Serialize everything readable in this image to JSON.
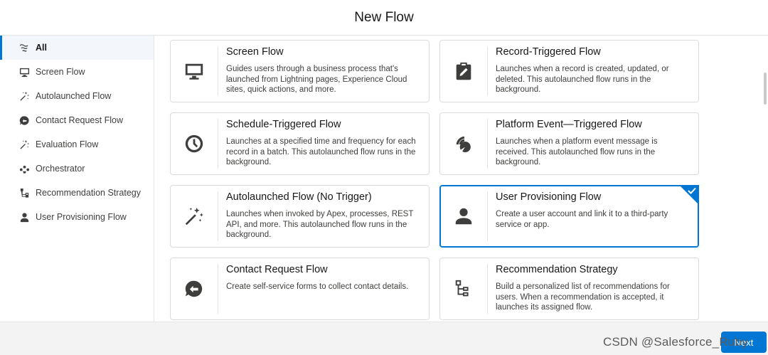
{
  "header": {
    "title": "New Flow"
  },
  "sidebar": {
    "items": [
      {
        "label": "All",
        "icon": "filter-icon"
      },
      {
        "label": "Screen Flow",
        "icon": "desktop-icon"
      },
      {
        "label": "Autolaunched Flow",
        "icon": "magic-wand-icon"
      },
      {
        "label": "Contact Request Flow",
        "icon": "chat-callback-icon"
      },
      {
        "label": "Evaluation Flow",
        "icon": "magic-wand-icon"
      },
      {
        "label": "Orchestrator",
        "icon": "orchestrator-icon"
      },
      {
        "label": "Recommendation Strategy",
        "icon": "hierarchy-icon"
      },
      {
        "label": "User Provisioning Flow",
        "icon": "user-icon"
      }
    ]
  },
  "cards": [
    {
      "title": "Screen Flow",
      "description": "Guides users through a business process that's launched from Lightning pages, Experience Cloud sites, quick actions, and more.",
      "icon": "desktop-icon"
    },
    {
      "title": "Record-Triggered Flow",
      "description": "Launches when a record is created, updated, or deleted. This autolaunched flow runs in the background.",
      "icon": "clipboard-edit-icon"
    },
    {
      "title": "Schedule-Triggered Flow",
      "description": "Launches at a specified time and frequency for each record in a batch. This autolaunched flow runs in the background.",
      "icon": "clock-icon"
    },
    {
      "title": "Platform Event—Triggered Flow",
      "description": "Launches when a platform event message is received. This autolaunched flow runs in the background.",
      "icon": "platform-event-icon"
    },
    {
      "title": "Autolaunched Flow (No Trigger)",
      "description": "Launches when invoked by Apex, processes, REST API, and more. This autolaunched flow runs in the background.",
      "icon": "magic-wand-icon"
    },
    {
      "title": "User Provisioning Flow",
      "description": "Create a user account and link it to a third-party service or app.",
      "icon": "user-icon",
      "selected": true
    },
    {
      "title": "Contact Request Flow",
      "description": "Create self-service forms to collect contact details.",
      "icon": "chat-callback-icon"
    },
    {
      "title": "Recommendation Strategy",
      "description": "Build a personalized list of recommendations for users. When a recommendation is accepted, it launches its assigned flow.",
      "icon": "hierarchy-icon"
    }
  ],
  "footer": {
    "next_label": "Next",
    "watermark": "CSDN @Salesforce_Ruby"
  },
  "colors": {
    "brand": "#0176d3",
    "selected_border": "#0176d3",
    "sidebar_active_bg": "#f3f6fa"
  }
}
